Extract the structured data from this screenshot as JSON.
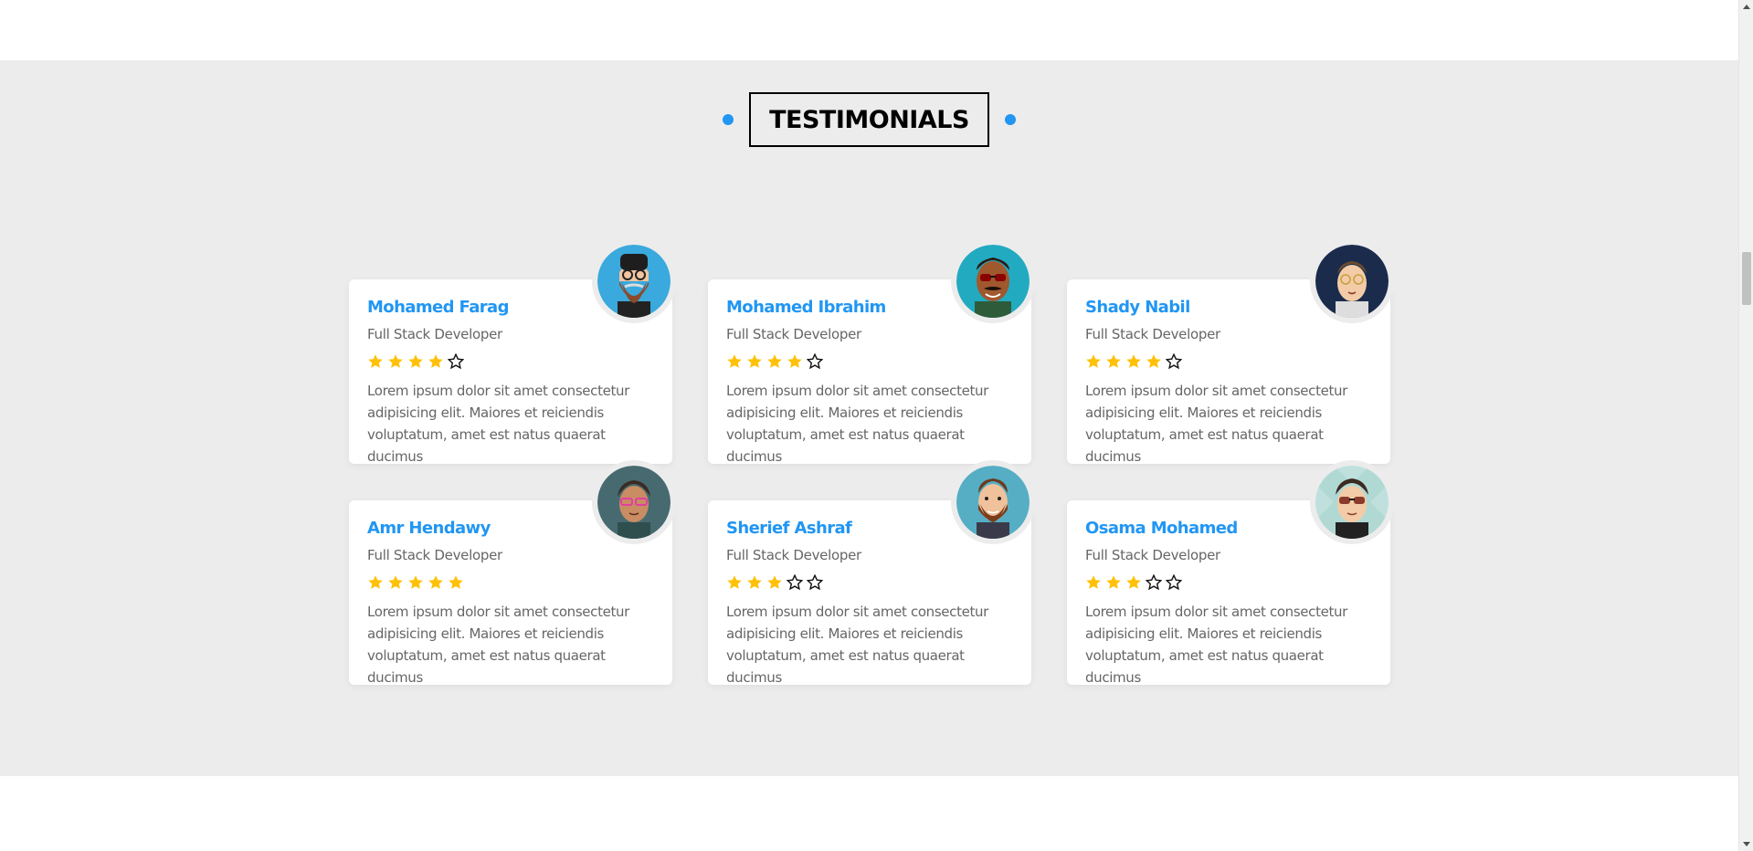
{
  "section": {
    "title": "TESTIMONIALS",
    "accent_color": "#2196f3",
    "name_color": "#2196f3",
    "star_color": "#ffc107"
  },
  "testimonials": [
    {
      "name": "Mohamed Farag",
      "role": "Full Stack Developer",
      "rating": 4,
      "max_rating": 5,
      "text": "Lorem ipsum dolor sit amet consectetur adipisicing elit. Maiores et reiciendis voluptatum, amet est natus quaerat ducimus",
      "avatar_icon": "bearded-man-glasses-cap-avatar",
      "avatar_bg": "#3aa9dd"
    },
    {
      "name": "Mohamed Ibrahim",
      "role": "Full Stack Developer",
      "rating": 4,
      "max_rating": 5,
      "text": "Lorem ipsum dolor sit amet consectetur adipisicing elit. Maiores et reiciendis voluptatum, amet est natus quaerat ducimus",
      "avatar_icon": "man-sunglasses-mustache-avatar",
      "avatar_bg": "#22aac1"
    },
    {
      "name": "Shady Nabil",
      "role": "Full Stack Developer",
      "rating": 4,
      "max_rating": 5,
      "text": "Lorem ipsum dolor sit amet consectetur adipisicing elit. Maiores et reiciendis voluptatum, amet est natus quaerat ducimus",
      "avatar_icon": "man-glasses-avatar",
      "avatar_bg": "#1a2b4c"
    },
    {
      "name": "Amr Hendawy",
      "role": "Full Stack Developer",
      "rating": 5,
      "max_rating": 5,
      "text": "Lorem ipsum dolor sit amet consectetur adipisicing elit. Maiores et reiciendis voluptatum, amet est natus quaerat ducimus",
      "avatar_icon": "man-pink-glasses-avatar",
      "avatar_bg": "#466a6f"
    },
    {
      "name": "Sherief Ashraf",
      "role": "Full Stack Developer",
      "rating": 3,
      "max_rating": 5,
      "text": "Lorem ipsum dolor sit amet consectetur adipisicing elit. Maiores et reiciendis voluptatum, amet est natus quaerat ducimus",
      "avatar_icon": "bearded-man-avatar",
      "avatar_bg": "#55aec4"
    },
    {
      "name": "Osama Mohamed",
      "role": "Full Stack Developer",
      "rating": 3,
      "max_rating": 5,
      "text": "Lorem ipsum dolor sit amet consectetur adipisicing elit. Maiores et reiciendis voluptatum, amet est natus quaerat ducimus",
      "avatar_icon": "man-sunglasses-avatar",
      "avatar_bg": "#bfe0dd"
    }
  ]
}
